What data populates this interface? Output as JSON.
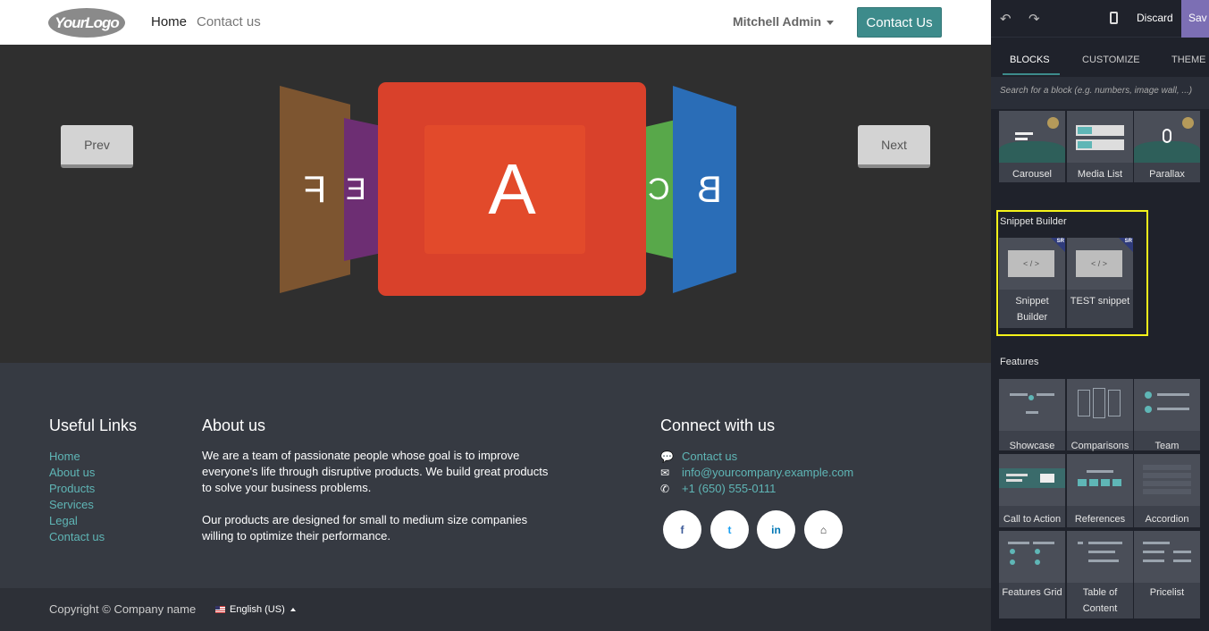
{
  "navbar": {
    "logo_text": "YourLogo",
    "links": [
      "Home",
      "Contact us"
    ],
    "user": "Mitchell Admin",
    "cta": "Contact Us"
  },
  "hero": {
    "prev": "Prev",
    "next": "Next",
    "panels": [
      "F",
      "E",
      "A",
      "C",
      "B"
    ],
    "colors": {
      "a": "#d9412b",
      "b": "#2a6db7",
      "c": "#58a84a",
      "e": "#6d2e73",
      "f": "#7d5530"
    }
  },
  "footer": {
    "useful_links_title": "Useful Links",
    "useful_links": [
      "Home",
      "About us",
      "Products",
      "Services",
      "Legal",
      "Contact us"
    ],
    "about_title": "About us",
    "about_p1": "We are a team of passionate people whose goal is to improve everyone's life through disruptive products. We build great products to solve your business problems.",
    "about_p2": "Our products are designed for small to medium size companies willing to optimize their performance.",
    "connect_title": "Connect with us",
    "contact_items": [
      {
        "icon": "comment-icon",
        "text": "Contact us"
      },
      {
        "icon": "envelope-icon",
        "text": "info@yourcompany.example.com"
      },
      {
        "icon": "phone-icon",
        "text": "+1 (650) 555-0111"
      }
    ],
    "social": [
      {
        "icon": "facebook-icon",
        "glyph": "f",
        "color": "#3b5998"
      },
      {
        "icon": "twitter-icon",
        "glyph": "t",
        "color": "#1da1f2"
      },
      {
        "icon": "linkedin-icon",
        "glyph": "in",
        "color": "#0077b5"
      },
      {
        "icon": "home-icon",
        "glyph": "⌂",
        "color": "#333333"
      }
    ]
  },
  "copyright": {
    "text": "Copyright © Company name",
    "language": "English (US)"
  },
  "editor": {
    "discard": "Discard",
    "save": "Sav",
    "tabs": [
      "BLOCKS",
      "CUSTOMIZE",
      "THEME"
    ],
    "search_placeholder": "Search for a block (e.g. numbers, image wall, ...)",
    "top_blocks": [
      "Carousel",
      "Media List",
      "Parallax"
    ],
    "snippet_section": "Snippet Builder",
    "snippet_blocks": [
      "Snippet Builder",
      "TEST snippet"
    ],
    "snippet_code": "< / >",
    "snippet_badge": "SR",
    "features_section": "Features",
    "feature_blocks": [
      "Showcase",
      "Comparisons",
      "Team",
      "Call to Action",
      "References",
      "Accordion",
      "Features Grid",
      "Table of Content",
      "Pricelist"
    ],
    "accent": "#3d8b8b",
    "highlight": "#f5f31a"
  }
}
